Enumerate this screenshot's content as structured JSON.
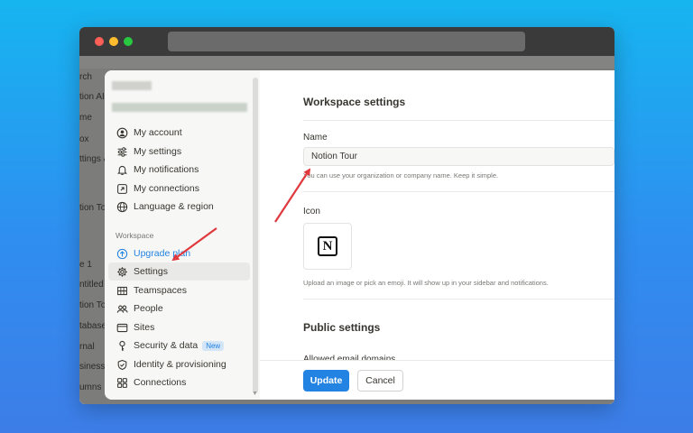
{
  "background_sidebar": [
    "rch",
    "tion AI",
    "me",
    "ox",
    "ttings &",
    "tion To",
    "e 1",
    "ntitled",
    "tion To",
    "tabase",
    "rnal",
    "siness",
    "umns"
  ],
  "sidebar": {
    "account_items": [
      {
        "label": "My account",
        "icon": "user-circle-icon"
      },
      {
        "label": "My settings",
        "icon": "sliders-icon"
      },
      {
        "label": "My notifications",
        "icon": "bell-icon"
      },
      {
        "label": "My connections",
        "icon": "external-link-icon"
      },
      {
        "label": "Language & region",
        "icon": "globe-icon"
      }
    ],
    "workspace_label": "Workspace",
    "workspace_items": [
      {
        "label": "Upgrade plan",
        "icon": "upgrade-icon"
      },
      {
        "label": "Settings",
        "icon": "gear-icon"
      },
      {
        "label": "Teamspaces",
        "icon": "teamspaces-icon"
      },
      {
        "label": "People",
        "icon": "people-icon"
      },
      {
        "label": "Sites",
        "icon": "sites-icon"
      },
      {
        "label": "Security & data",
        "icon": "key-icon",
        "badge": "New"
      },
      {
        "label": "Identity & provisioning",
        "icon": "shield-icon"
      },
      {
        "label": "Connections",
        "icon": "grid-icon"
      }
    ]
  },
  "content": {
    "title": "Workspace settings",
    "name_label": "Name",
    "name_value": "Notion Tour",
    "name_hint": "You can use your organization or company name. Keep it simple.",
    "icon_label": "Icon",
    "icon_glyph": "N",
    "icon_hint": "Upload an image or pick an emoji. It will show up in your sidebar and notifications.",
    "public_title": "Public settings",
    "cut_text": "Allowed email domains"
  },
  "footer": {
    "update_label": "Update",
    "cancel_label": "Cancel"
  },
  "colors": {
    "accent": "#2383e2",
    "annotation_arrow": "#e0393e"
  }
}
